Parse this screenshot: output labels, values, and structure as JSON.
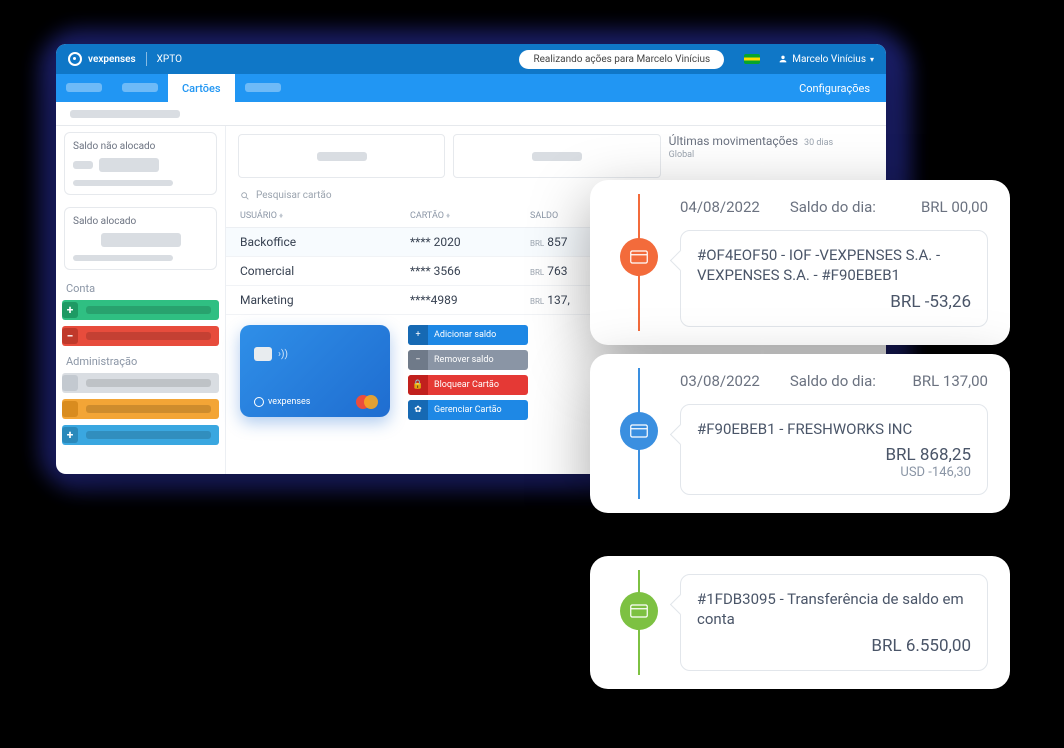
{
  "header": {
    "brand": "vexpenses",
    "company": "XPTO",
    "acting_for": "Realizando ações para Marcelo Vinícius",
    "user": "Marcelo Vinícius"
  },
  "tabs": {
    "active": "Cartões",
    "settings": "Configurações"
  },
  "sidebar": {
    "card1_title": "Saldo não alocado",
    "card2_title": "Saldo alocado",
    "section_account": "Conta",
    "section_admin": "Administração"
  },
  "main": {
    "movements_title": "Últimas movimentações",
    "movements_sub_days": "30 dias",
    "movements_sub_scope": "Global",
    "search_placeholder": "Pesquisar cartão",
    "headers": {
      "user": "USUÁRIO",
      "card": "CARTÃO",
      "balance": "SALDO"
    },
    "rows": [
      {
        "user": "Backoffice",
        "card": "**** 2020",
        "cur": "BRL",
        "bal": "857"
      },
      {
        "user": "Comercial",
        "card": "**** 3566",
        "cur": "BRL",
        "bal": "763"
      },
      {
        "user": "Marketing",
        "card": "****4989",
        "cur": "BRL",
        "bal": "137,"
      }
    ],
    "card_brand": "vexpenses",
    "buttons": {
      "add": "Adicionar saldo",
      "remove": "Remover saldo",
      "block": "Bloquear Cartão",
      "manage": "Gerenciar Cartão"
    }
  },
  "popups": [
    {
      "date": "04/08/2022",
      "label": "Saldo do dia:",
      "amount": "BRL 00,00",
      "desc": "#OF4EOF50 - IOF -VEXPENSES S.A. - VEXPENSES S.A. - #F90EBEB1",
      "val": "BRL -53,26"
    },
    {
      "date": "03/08/2022",
      "label": "Saldo do dia:",
      "amount": "BRL 137,00",
      "desc": "#F90EBEB1 - FRESHWORKS INC",
      "val": "BRL 868,25",
      "val2": "USD -146,30"
    },
    {
      "desc": "#1FDB3095 - Transferência de saldo em conta",
      "val": "BRL 6.550,00"
    }
  ]
}
